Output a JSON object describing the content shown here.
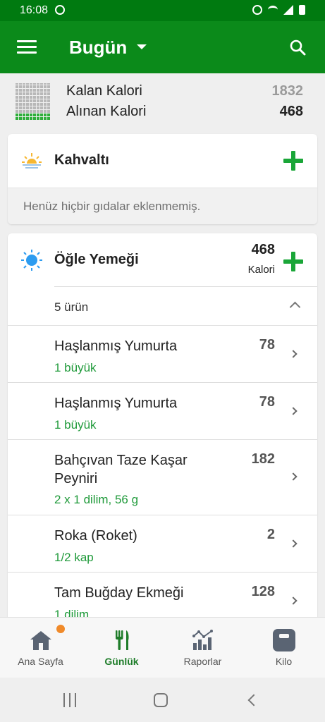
{
  "status": {
    "time": "16:08"
  },
  "appbar": {
    "title": "Bugün"
  },
  "summary": {
    "remaining_label": "Kalan Kalori",
    "remaining_value": "1832",
    "consumed_label": "Alınan Kalori",
    "consumed_value": "468",
    "consumed_fraction": 0.2
  },
  "breakfast": {
    "title": "Kahvaltı",
    "empty_text": "Henüz hiçbir gıdalar eklenmemiş."
  },
  "lunch": {
    "title": "Öğle Yemeği",
    "calories": "468",
    "calories_unit": "Kalori",
    "count_label": "5 ürün",
    "items": [
      {
        "name": "Haşlanmış Yumurta",
        "amount": "1 büyük",
        "calories": "78"
      },
      {
        "name": "Haşlanmış Yumurta",
        "amount": "1 büyük",
        "calories": "78"
      },
      {
        "name": "Bahçıvan Taze Kaşar Peyniri",
        "amount": "2 x 1 dilim, 56 g",
        "calories": "182"
      },
      {
        "name": "Roka (Roket)",
        "amount": "1/2 kap",
        "calories": "2"
      },
      {
        "name": "Tam Buğday Ekmeği",
        "amount": "1 dilim",
        "calories": "128"
      }
    ]
  },
  "bottom_nav": [
    {
      "label": "Ana Sayfa",
      "icon": "home-icon"
    },
    {
      "label": "Günlük",
      "icon": "utensils-icon"
    },
    {
      "label": "Raporlar",
      "icon": "reports-icon"
    },
    {
      "label": "Kilo",
      "icon": "scale-icon"
    }
  ],
  "colors": {
    "appbar": "#0b8a1a",
    "statusbar": "#007a10",
    "accent": "#1aa638",
    "amount_text": "#1f9a3a",
    "badge": "#f08a2a"
  }
}
